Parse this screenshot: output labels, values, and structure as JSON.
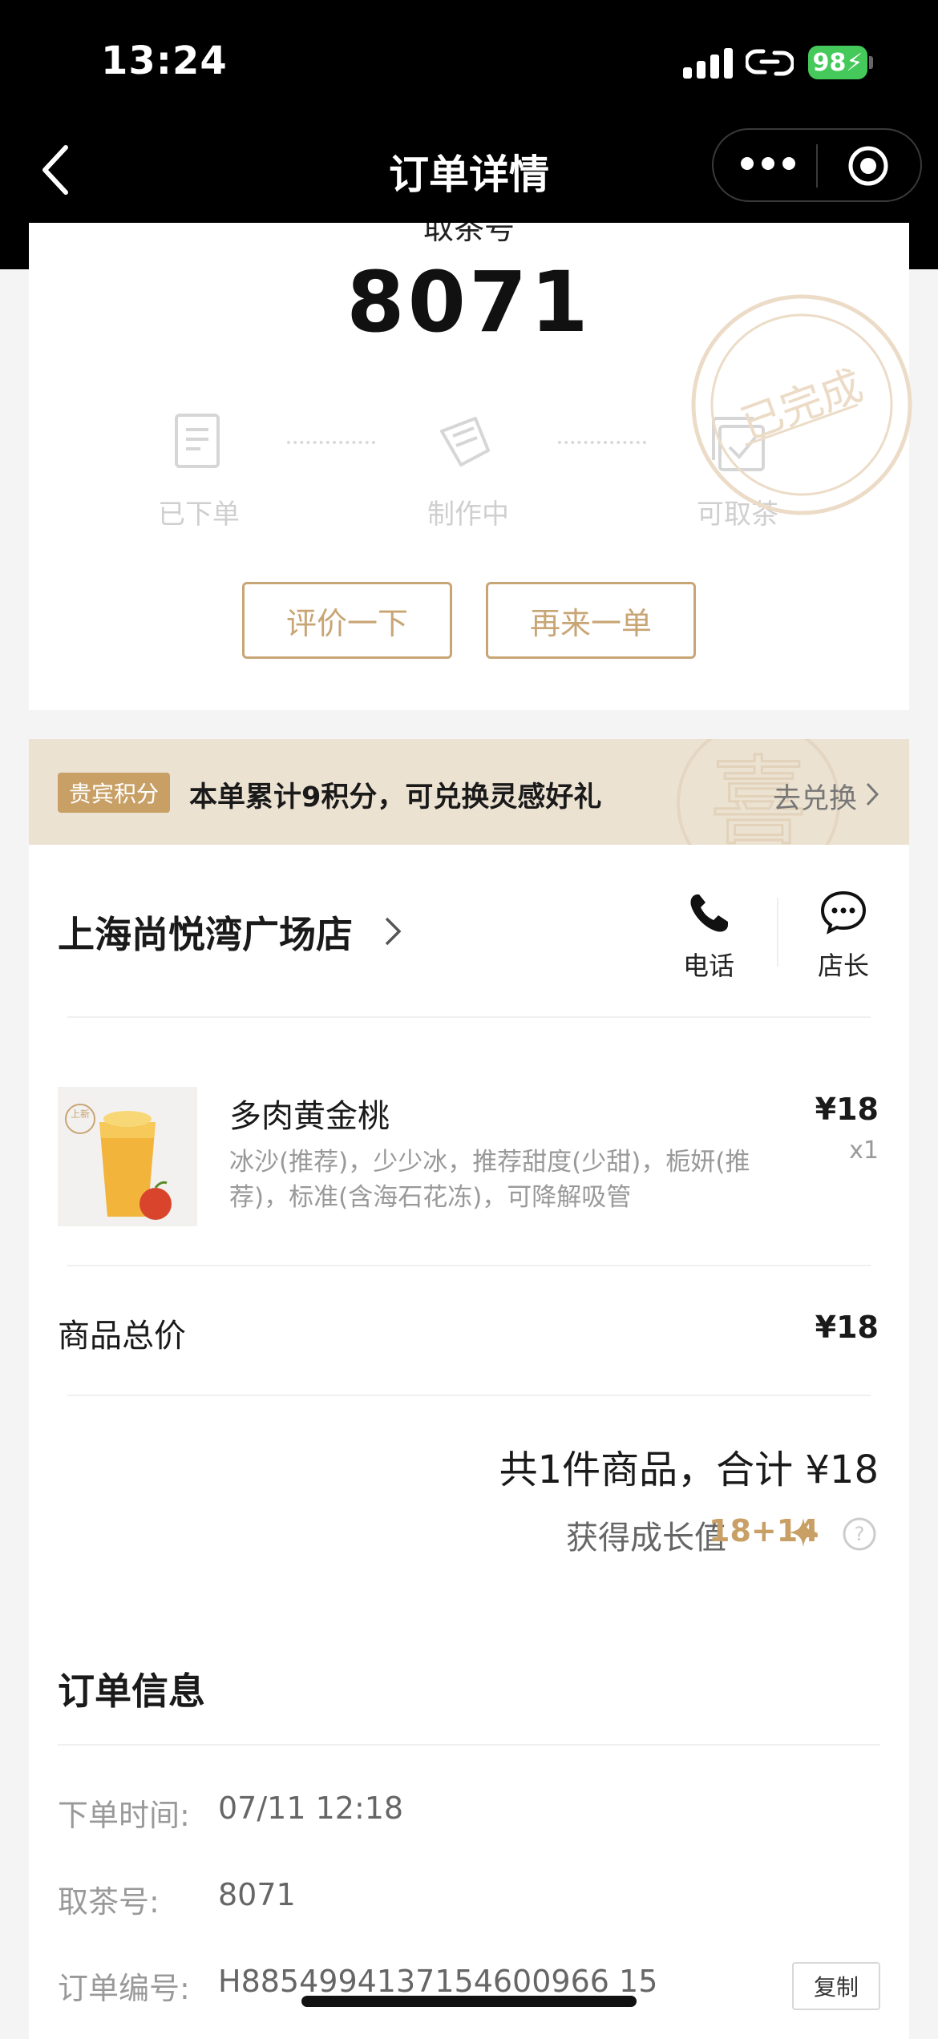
{
  "status_bar": {
    "time": "13:24",
    "battery": "98"
  },
  "nav": {
    "title": "订单详情"
  },
  "pickup": {
    "label": "取茶号",
    "number": "8071",
    "steps": [
      "已下单",
      "制作中",
      "可取茶"
    ],
    "stamp_text": "已完成",
    "review_button": "评价一下",
    "reorder_button": "再来一单"
  },
  "points": {
    "badge": "贵宾积分",
    "text": "本单累计9积分，可兑换灵感好礼",
    "redeem": "去兑换"
  },
  "store": {
    "name": "上海尚悦湾广场店",
    "phone_label": "电话",
    "manager_label": "店长"
  },
  "product": {
    "image_badge": "上新",
    "name": "多肉黄金桃",
    "options": "冰沙(推荐)，少少冰，推荐甜度(少甜)，栀妍(推荐)，标准(含海石花冻)，可降解吸管",
    "price": "¥18",
    "qty": "x1"
  },
  "summary": {
    "subtotal_label": "商品总价",
    "subtotal_value": "¥18",
    "total_line": "共1件商品，合计 ¥18",
    "growth_label": "获得成长值",
    "growth_value": "18+14"
  },
  "order_info": {
    "title": "订单信息",
    "rows": [
      {
        "label": "下单时间:",
        "value": "07/11 12:18"
      },
      {
        "label": "取茶号:",
        "value": "8071"
      },
      {
        "label": "订单编号:",
        "value": "H8854994137154600966 15"
      }
    ],
    "copy_button": "复制"
  },
  "colors": {
    "accent_gold": "#c8a575",
    "banner_bg": "#ece2d2",
    "battery_green": "#45c95a"
  }
}
